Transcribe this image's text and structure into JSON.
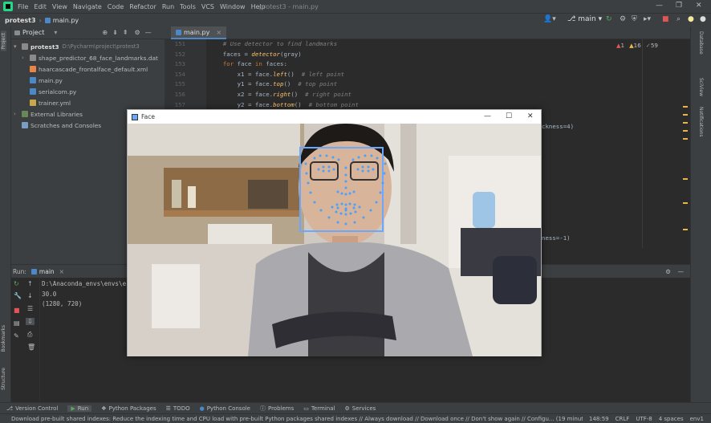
{
  "menubar": {
    "items": [
      "File",
      "Edit",
      "View",
      "Navigate",
      "Code",
      "Refactor",
      "Run",
      "Tools",
      "VCS",
      "Window",
      "Help"
    ],
    "window_title": "protest3 - main.py"
  },
  "navbar": {
    "project": "protest3",
    "file": "main.py",
    "branch": "main"
  },
  "project_panel": {
    "title": "Project",
    "root": "protest3",
    "root_path": "D:\\Pycharm\\project\\protest3",
    "files": [
      "shape_predictor_68_face_landmarks.dat",
      "haarcascade_frontalface_default.xml",
      "main.py",
      "serialcom.py",
      "trainer.yml"
    ],
    "external": "External Libraries",
    "scratches": "Scratches and Consoles"
  },
  "editor": {
    "tab": "main.py",
    "line_numbers": [
      "151",
      "152",
      "153",
      "154",
      "155",
      "156",
      "157"
    ],
    "inspections": {
      "errors": "1",
      "warnings": "16",
      "weak": "59"
    },
    "tail_fragments": [
      "ckness=4)",
      "ness=-1)"
    ]
  },
  "run": {
    "label": "Run:",
    "config": "main",
    "output": [
      "D:\\Anaconda_envs\\envs\\e",
      "30.0",
      "(1280, 720)"
    ]
  },
  "face_window": {
    "title": "Face"
  },
  "left_tabs": [
    "Project",
    "Bookmarks",
    "Structure"
  ],
  "right_tabs": [
    "Database",
    "SciView",
    "Notifications"
  ],
  "bottom_tabs": [
    "Version Control",
    "Run",
    "Python Packages",
    "TODO",
    "Python Console",
    "Problems",
    "Terminal",
    "Services"
  ],
  "status": {
    "message": "Download pre-built shared indexes: Reduce the indexing time and CPU load with pre-built Python packages shared indexes // Always download // Download once // Don't show again // Configu... (19 minutes ag",
    "position": "148:59",
    "line_sep": "CRLF",
    "encoding": "UTF-8",
    "indent": "4 spaces",
    "interpreter": "env1"
  },
  "colors": {
    "accent": "#4a88c7",
    "landmark": "#4aa0ff",
    "facebox": "#6aa8ff"
  }
}
